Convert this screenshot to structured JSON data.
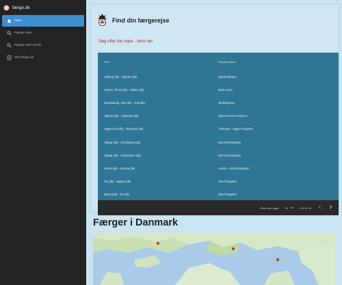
{
  "sidebar": {
    "title": "færge.dk",
    "items": [
      {
        "label": "Hjem",
        "icon": "home-icon",
        "active": true
      },
      {
        "label": "Færge-ruter",
        "icon": "search-icon",
        "active": false
      },
      {
        "label": "Færge-ruter (Kort)",
        "icon": "search-icon",
        "active": false
      },
      {
        "label": "Om færge.dk",
        "icon": "info-icon",
        "active": false
      }
    ]
  },
  "card": {
    "title": "Find din færgerejse",
    "subtitle": "Søg efter din rejse - skriv her"
  },
  "table": {
    "columns": [
      "Rute",
      "Færgeselskab"
    ],
    "rows": [
      [
        "Aalborg (dk) - Egholm (dk)",
        "Egholmfærgen"
      ],
      [
        "Aarhus, Århus (dk) - Odden (dk)",
        "Mols-Linien"
      ],
      [
        "Ærøskøbing, Ærø (dk) - Svendbo",
        "Ærøfærgerne"
      ],
      [
        "Agersø (dk) - Stigsnæs (dk)",
        "Agersø-Omø Færgerne"
      ],
      [
        "Aggersund (dk) - Thyborøn (dk)",
        "Thyborøn - Agger Færgefart"
      ],
      [
        "Allinge (dk) - Christiansø (dk)",
        "Bornholmslinjeeks"
      ],
      [
        "Allinge (dk) - Simrishamn (dk)",
        "Bornholmslinjeeks"
      ],
      [
        "Anholt (dk) - Grenaa (dk)",
        "Anholt - Anholt Færgefart"
      ],
      [
        "Års (dk) - Bøjden (dk)",
        "Ærø Færgefart"
      ],
      [
        "Barsø (dk) - Års (dk)",
        "Ærø Færgefart"
      ]
    ],
    "footer": {
      "rows_per_page_label": "Rows per page:",
      "rows_per_page_value": "10",
      "range": "1-10 of 76"
    }
  },
  "map_section": {
    "title": "Færger i Danmark"
  },
  "colors": {
    "sidebar_bg": "#232323",
    "active_item": "#3d8fd2",
    "table_bg": "#2f7594",
    "page_bg": "#c9e4f2",
    "accent_red": "#b3282d"
  }
}
